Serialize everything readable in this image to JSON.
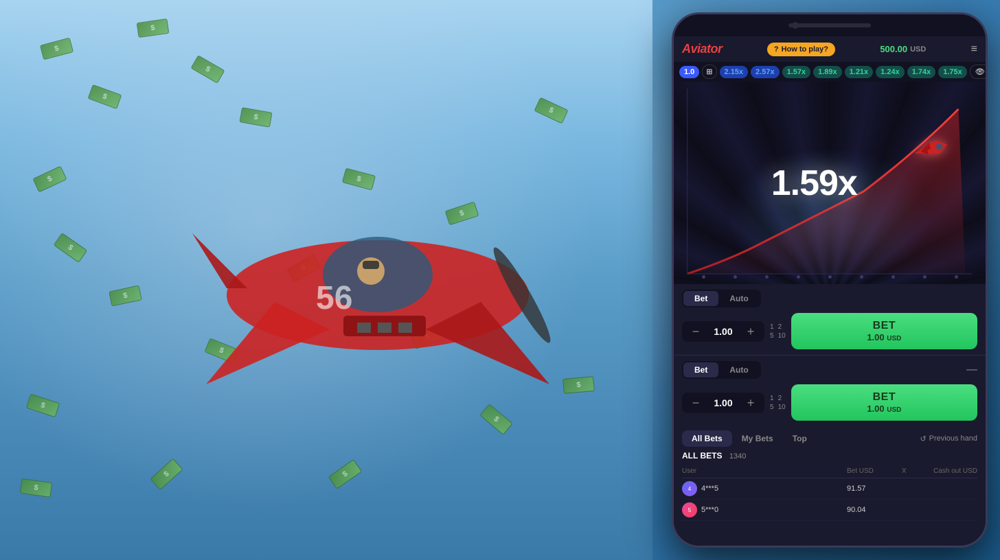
{
  "background": {
    "alt": "Aviator game background with red airplane and falling money bills"
  },
  "header": {
    "logo": "Aviator",
    "how_to_play": "How to play?",
    "balance": "500.00",
    "currency": "USD",
    "menu_icon": "≡"
  },
  "multiplier_history": [
    {
      "value": "1.0",
      "style": "active"
    },
    {
      "value": "2.15x",
      "style": "blue"
    },
    {
      "value": "2.57x",
      "style": "blue"
    },
    {
      "value": "1.57x",
      "style": "teal"
    },
    {
      "value": "1.89x",
      "style": "teal"
    },
    {
      "value": "1.21x",
      "style": "teal"
    },
    {
      "value": "1.24x",
      "style": "teal"
    },
    {
      "value": "1.74x",
      "style": "teal"
    },
    {
      "value": "1.75x",
      "style": "teal"
    }
  ],
  "game": {
    "multiplier": "1.59x",
    "plane_icon": "✈"
  },
  "bet_panel_1": {
    "tab_bet": "Bet",
    "tab_auto": "Auto",
    "amount": "1.00",
    "quick_bets_row1": [
      "1",
      "2"
    ],
    "quick_bets_row2": [
      "5",
      "10"
    ],
    "bet_label": "BET",
    "bet_amount": "1.00",
    "bet_currency": "USD"
  },
  "bet_panel_2": {
    "tab_bet": "Bet",
    "tab_auto": "Auto",
    "amount": "1.00",
    "quick_bets_row1": [
      "1",
      "2"
    ],
    "quick_bets_row2": [
      "5",
      "10"
    ],
    "bet_label": "BET",
    "bet_amount": "1.00",
    "bet_currency": "USD",
    "minus_icon": "—"
  },
  "bottom_tabs": {
    "all_bets": "All Bets",
    "my_bets": "My Bets",
    "top": "Top",
    "previous_hand": "Previous hand",
    "refresh_icon": "↺"
  },
  "bets_section": {
    "title": "ALL BETS",
    "count": "1340",
    "columns": {
      "user": "User",
      "bet_usd": "Bet USD",
      "x": "X",
      "cash_out_usd": "Cash out USD"
    },
    "rows": [
      {
        "avatar_initials": "4",
        "username": "4***5",
        "bet": "91.57",
        "x": "",
        "cashout": ""
      },
      {
        "avatar_initials": "5",
        "username": "5***0",
        "bet": "90.04",
        "x": "",
        "cashout": ""
      }
    ]
  },
  "dots": [
    "•",
    "•",
    "•",
    "•",
    "•",
    "•",
    "•",
    "•",
    "•"
  ]
}
